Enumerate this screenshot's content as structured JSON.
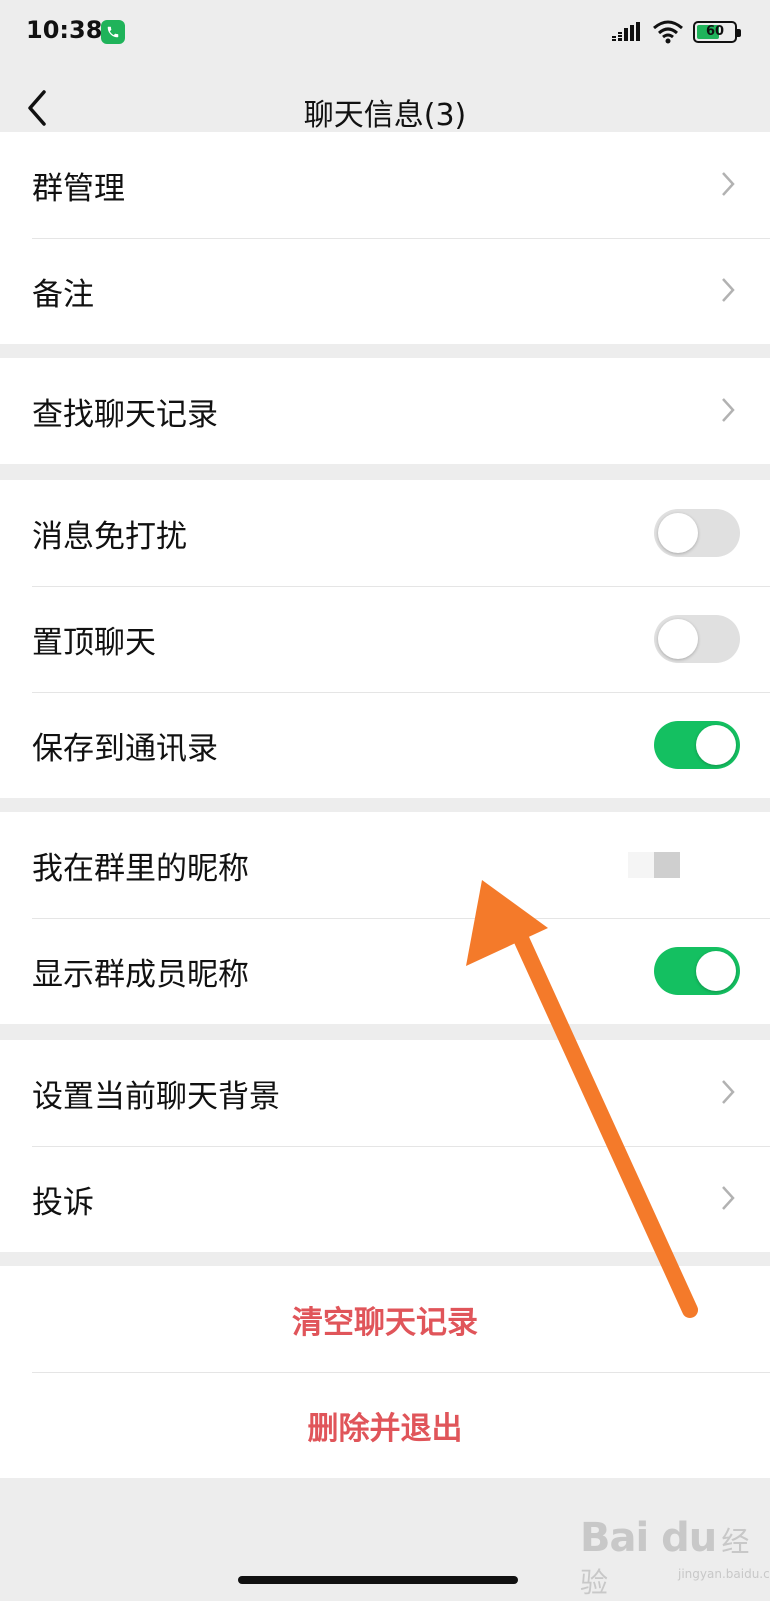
{
  "status": {
    "time": "10:38",
    "battery_level": 60,
    "battery_label": "60",
    "icons": [
      "phone-call-icon",
      "signal-icon",
      "wifi-icon",
      "battery-icon"
    ]
  },
  "header": {
    "title": "聊天信息(3)",
    "back_icon": "chevron-left-icon"
  },
  "groups": {
    "management": {
      "group_manage": "群管理",
      "remark": "备注"
    },
    "search": {
      "find_history": "查找聊天记录"
    },
    "toggles": {
      "mute": {
        "label": "消息免打扰",
        "on": false
      },
      "pin": {
        "label": "置顶聊天",
        "on": false
      },
      "save_contacts": {
        "label": "保存到通讯录",
        "on": true
      }
    },
    "nickname": {
      "my_nickname": "我在群里的昵称",
      "show_member_nickname": {
        "label": "显示群成员昵称",
        "on": true
      }
    },
    "misc": {
      "set_background": "设置当前聊天背景",
      "complain": "投诉"
    }
  },
  "actions": {
    "clear_history": "清空聊天记录",
    "delete_exit": "删除并退出"
  },
  "watermark": {
    "brand": "Bai du",
    "suffix": "经验",
    "url": "jingyan.baidu.com"
  },
  "colors": {
    "toggle_on": "#14c061",
    "toggle_off": "#e0e0e0",
    "danger": "#e0555a",
    "annotation_arrow": "#f47a2a",
    "background": "#ededed"
  }
}
